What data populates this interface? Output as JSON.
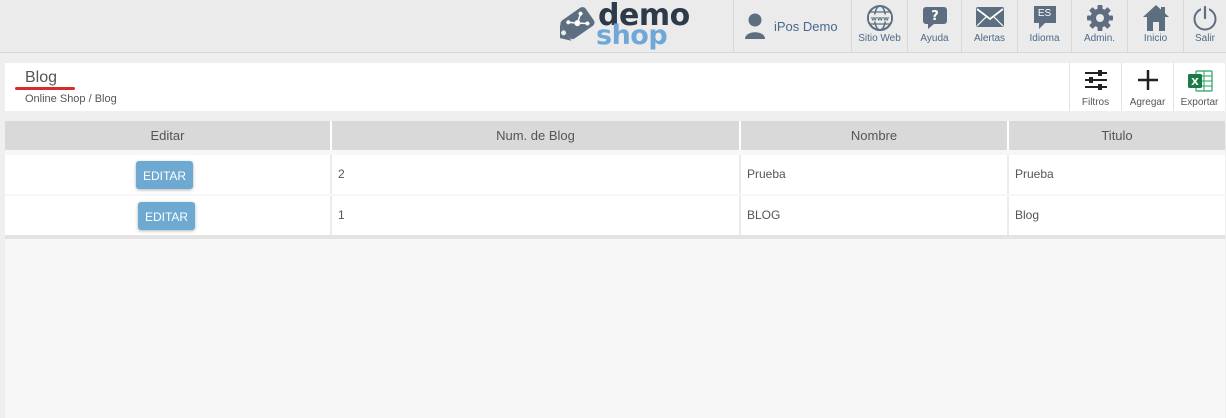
{
  "topbar": {
    "logo": {
      "line1": "demo",
      "line2": "shop"
    },
    "user": {
      "name": "iPos Demo"
    },
    "nav": [
      {
        "label": "Sitio Web",
        "icon": "globe-icon"
      },
      {
        "label": "Ayuda",
        "icon": "help-icon"
      },
      {
        "label": "Alertas",
        "icon": "envelope-icon"
      },
      {
        "label": "Idioma",
        "icon": "language-icon",
        "badge": "ES"
      },
      {
        "label": "Admin.",
        "icon": "gear-icon"
      },
      {
        "label": "Inicio",
        "icon": "home-icon"
      },
      {
        "label": "Salir",
        "icon": "power-icon"
      }
    ]
  },
  "header": {
    "title": "Blog",
    "breadcrumb": "Online Shop / Blog",
    "tools": [
      {
        "label": "Filtros",
        "icon": "sliders-icon"
      },
      {
        "label": "Agregar",
        "icon": "plus-icon"
      },
      {
        "label": "Exportar",
        "icon": "excel-icon"
      }
    ]
  },
  "table": {
    "columns": [
      "Editar",
      "Num. de Blog",
      "Nombre",
      "Titulo"
    ],
    "edit_label": "EDITAR",
    "rows": [
      {
        "num": "2",
        "nombre": "Prueba",
        "titulo": "Prueba"
      },
      {
        "num": "1",
        "nombre": "BLOG",
        "titulo": "Blog"
      }
    ]
  },
  "colors": {
    "accent": "#6ea9d2",
    "underline": "#d62c2c",
    "logo_dark": "#2d3a4a",
    "logo_light": "#6fa8d6"
  }
}
